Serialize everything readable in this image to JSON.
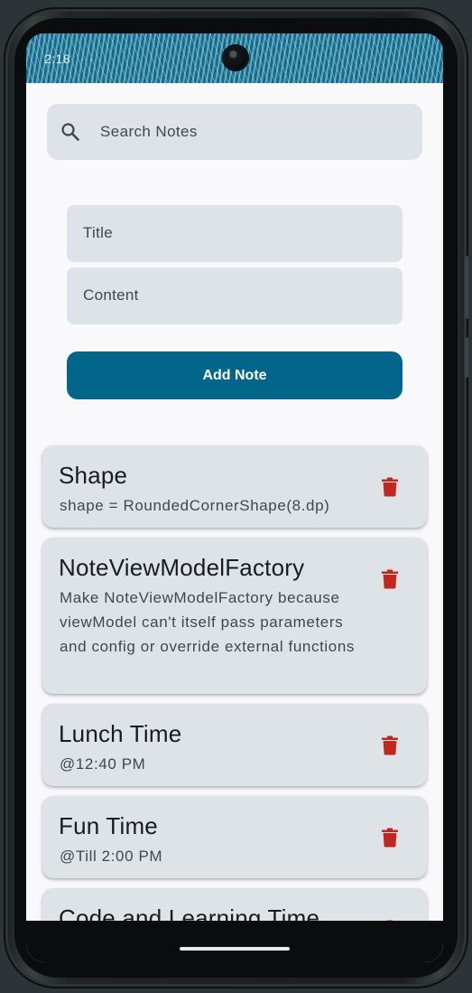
{
  "status_bar": {
    "time": "2:18",
    "extra": "· ·"
  },
  "search": {
    "placeholder": "Search Notes",
    "icon": "search-icon"
  },
  "form": {
    "title_placeholder": "Title",
    "content_placeholder": "Content",
    "add_button_label": "Add Note"
  },
  "notes": [
    {
      "title": "Shape",
      "content": "shape = RoundedCornerShape(8.dp)"
    },
    {
      "title": "NoteViewModelFactory",
      "content": "Make NoteViewModelFactory because viewModel can't itself pass parameters and config or override external functions"
    },
    {
      "title": "Lunch Time",
      "content": "@12:40 PM"
    },
    {
      "title": "Fun Time",
      "content": "@Till 2:00 PM"
    },
    {
      "title": "Code and Learning Time",
      "content": ""
    }
  ],
  "colors": {
    "primary": "#02668a",
    "surface_variant": "#dde3e8",
    "delete": "#c0281e",
    "background": "#f9f9fc"
  }
}
